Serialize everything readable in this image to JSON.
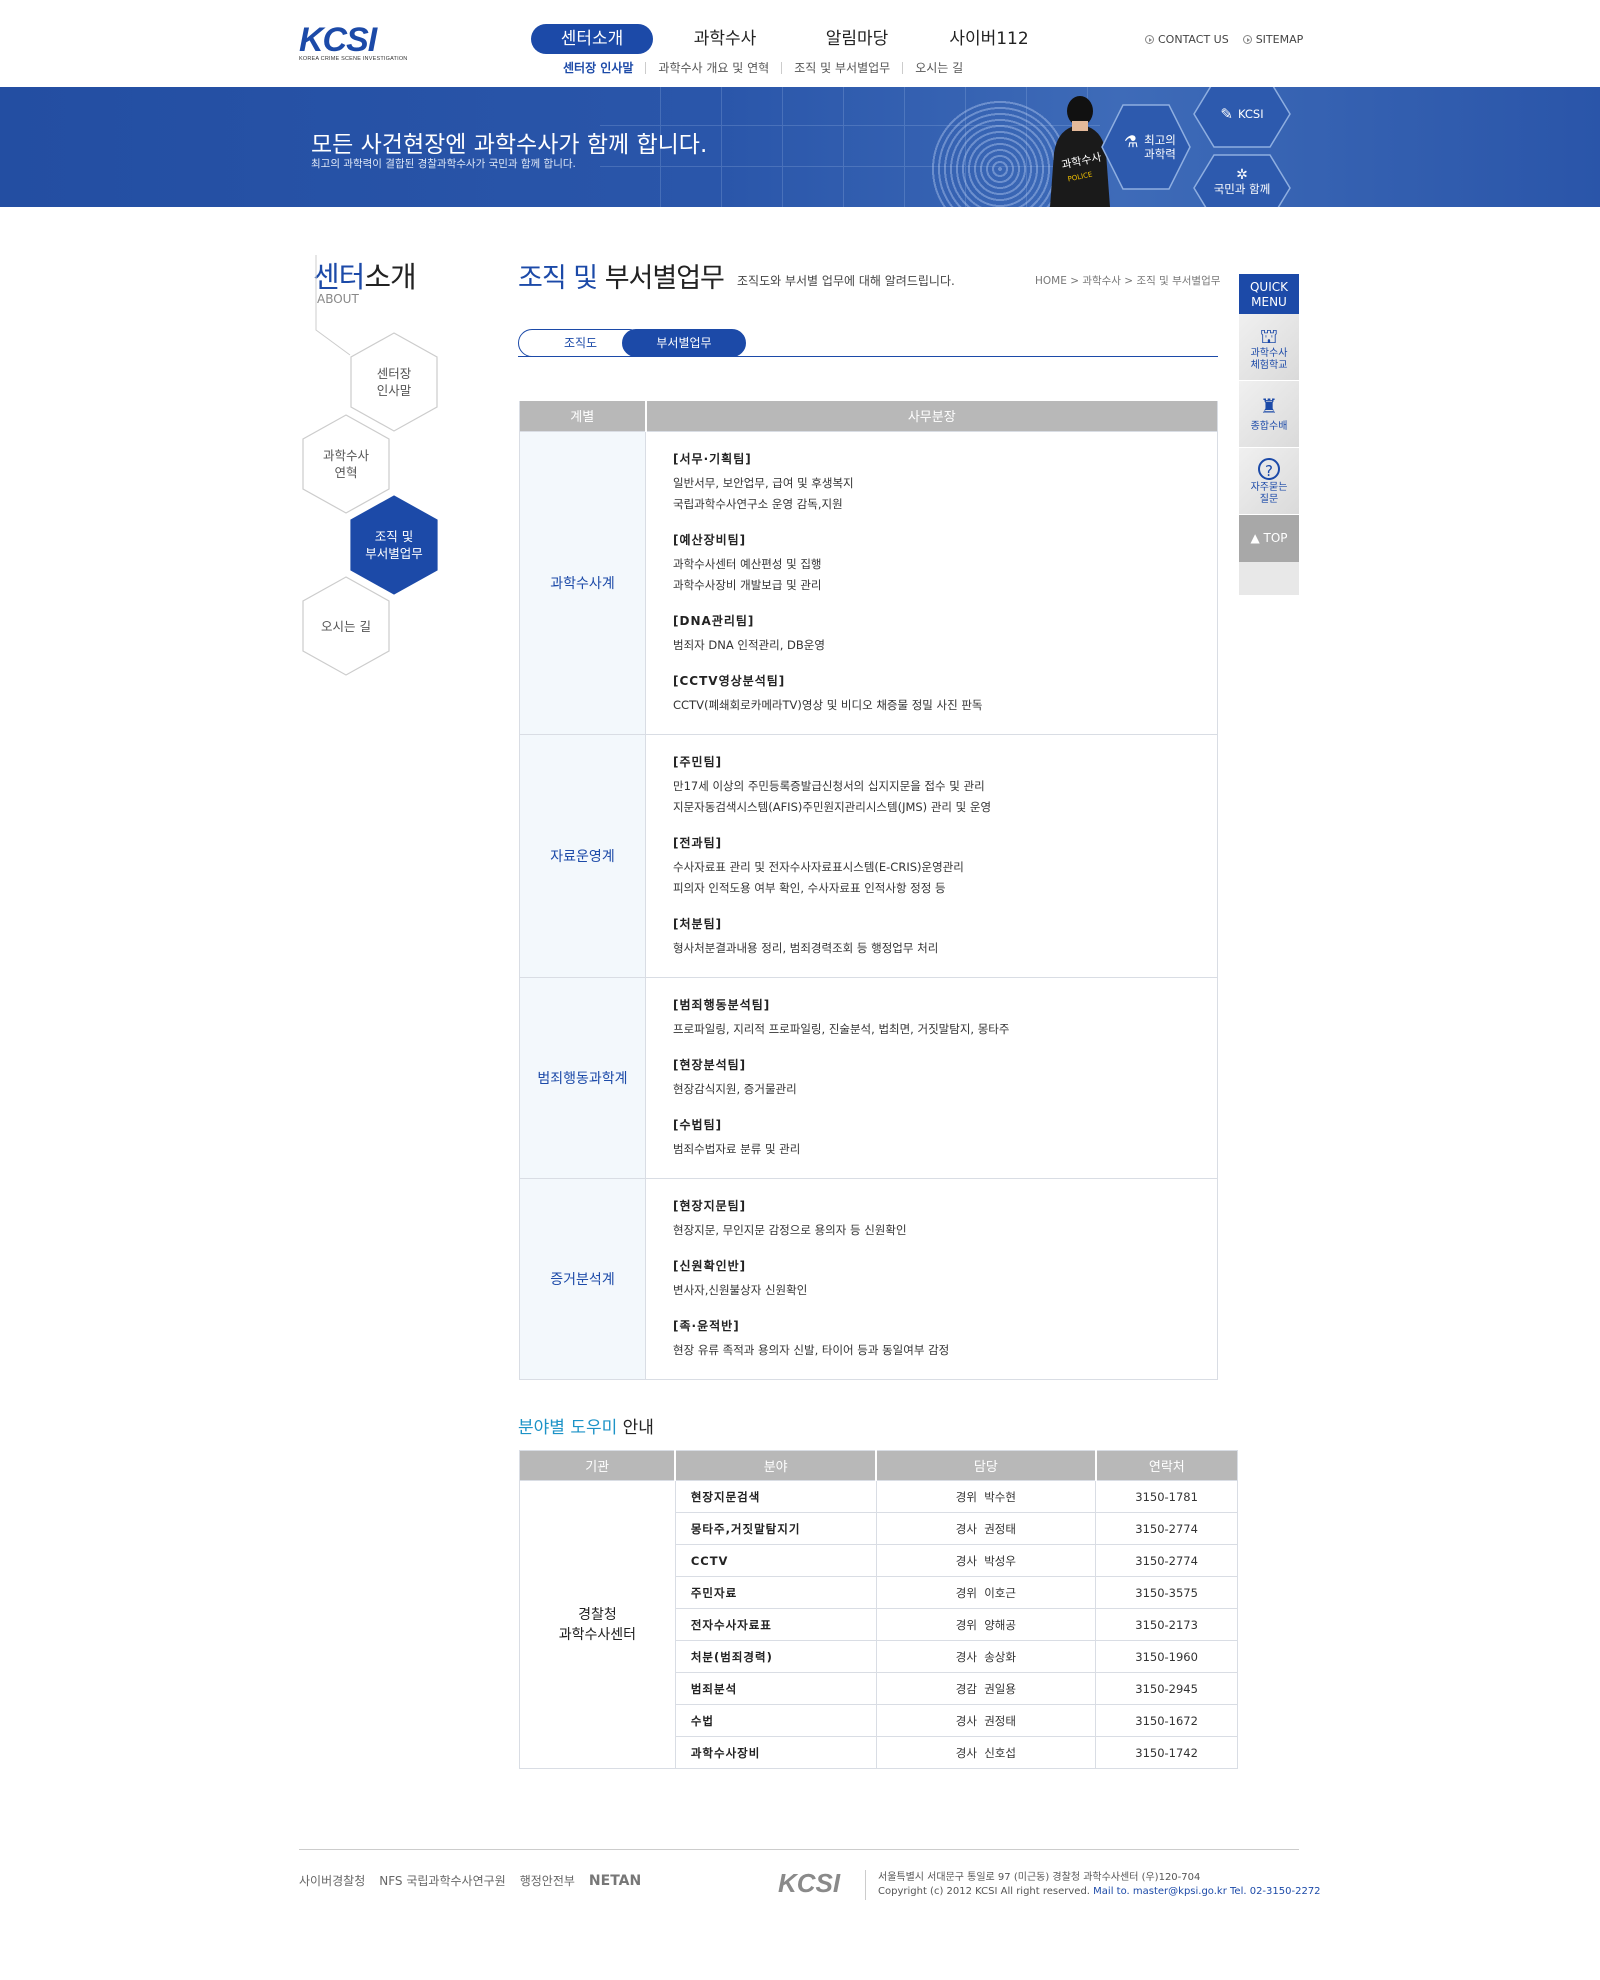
{
  "header": {
    "logo_text": "KCSI",
    "logo_sub": "KOREA CRIME SCENE INVESTIGATION",
    "gnb": [
      "센터소개",
      "과학수사",
      "알림마당",
      "사이버112"
    ],
    "lnb": [
      "센터장 인사말",
      "과학수사 개요 및 연혁",
      "조직 및 부서별업무",
      "오시는 길"
    ],
    "util": [
      "CONTACT US",
      "SITEMAP"
    ]
  },
  "banner": {
    "title": "모든 사건현장엔 과학수사가 함께 합니다.",
    "subtitle": "최고의 과학력이 결합된 경찰과학수사가 국민과 함께 합니다.",
    "person_badge": "과학수사",
    "person_police": "POLICE",
    "hex1": "최고의\n과학력",
    "hex2": "KCSI",
    "hex3": "국민과 함께"
  },
  "side": {
    "title_blue": "센터",
    "title_rest": "소개",
    "about": "ABOUT",
    "items": [
      "센터장\n인사말",
      "과학수사\n연혁",
      "조직 및\n부서별업무",
      "오시는 길"
    ]
  },
  "content": {
    "title_blue": "조직 및",
    "title_rest": " 부서별업무",
    "desc": "조직도와 부서별 업무에 대해 알려드립니다.",
    "breadcrumb": "HOME > 과학수사 > 조직 및 부서별업무",
    "tabs": [
      "조직도",
      "부서별업무"
    ],
    "table_headers": [
      "계별",
      "사무분장"
    ],
    "rows": [
      {
        "dept": "과학수사계",
        "teams": [
          {
            "name": "[서무·기획팀]",
            "lines": [
              "일반서무, 보안업무, 급여 및 후생복지",
              "국립과학수사연구소 운영 감독,지원"
            ]
          },
          {
            "name": "[예산장비팀]",
            "lines": [
              "과학수사센터 예산편성 및 집행",
              "과학수사장비 개발보급 및 관리"
            ]
          },
          {
            "name": "[DNA관리팀]",
            "lines": [
              "범죄자 DNA 인적관리, DB운영"
            ]
          },
          {
            "name": "[CCTV영상분석팀]",
            "lines": [
              "CCTV(폐쇄회로카메라TV)영상 및 비디오 채증물 정밀 사진 판독"
            ]
          }
        ]
      },
      {
        "dept": "자료운영계",
        "teams": [
          {
            "name": "[주민팀]",
            "lines": [
              "만17세 이상의 주민등록증발급신청서의 십지지문을 접수 및 관리",
              "지문자동검색시스템(AFIS)주민원지관리시스템(JMS) 관리 및 운영"
            ]
          },
          {
            "name": "[전과팀]",
            "lines": [
              "수사자료표 관리 및 전자수사자료표시스템(E-CRIS)운영관리",
              "피의자 인적도용 여부 확인, 수사자료표 인적사항 정정 등"
            ]
          },
          {
            "name": "[처분팀]",
            "lines": [
              "형사처분결과내용 정리, 범죄경력조회 등 행정업무 처리"
            ]
          }
        ]
      },
      {
        "dept": "범죄행동과학계",
        "teams": [
          {
            "name": "[범죄행동분석팀]",
            "lines": [
              "프로파일링, 지리적 프로파일링, 진술분석, 법최면, 거짓말탐지, 몽타주"
            ]
          },
          {
            "name": "[현장분석팀]",
            "lines": [
              "현장감식지원, 증거물관리"
            ]
          },
          {
            "name": "[수법팀]",
            "lines": [
              "범죄수법자료 분류 및 관리"
            ]
          }
        ]
      },
      {
        "dept": "증거분석계",
        "teams": [
          {
            "name": "[현장지문팀]",
            "lines": [
              "현장지문, 무인지문 감정으로 용의자 등 신원확인"
            ]
          },
          {
            "name": "[신원확인반]",
            "lines": [
              "변사자,신원불상자 신원확인"
            ]
          },
          {
            "name": "[족·윤적반]",
            "lines": [
              "현장 유류 족적과 용의자 신발, 타이어 등과 동일여부 감정"
            ]
          }
        ]
      }
    ]
  },
  "helper": {
    "title_blue": "분야별 도우미",
    "title_rest": " 안내",
    "headers": [
      "기관",
      "분야",
      "담당",
      "연락처"
    ],
    "org": "경찰청\n과학수사센터",
    "rows": [
      {
        "field": "현장지문검색",
        "person": "경위  박수현",
        "tel": "3150-1781"
      },
      {
        "field": "몽타주,거짓말탐지기",
        "person": "경사  권정태",
        "tel": "3150-2774"
      },
      {
        "field": "CCTV",
        "person": "경사  박성우",
        "tel": "3150-2774"
      },
      {
        "field": "주민자료",
        "person": "경위  이호근",
        "tel": "3150-3575"
      },
      {
        "field": "전자수사자료표",
        "person": "경위  양해공",
        "tel": "3150-2173"
      },
      {
        "field": "처분(범죄경력)",
        "person": "경사  송상화",
        "tel": "3150-1960"
      },
      {
        "field": "범죄분석",
        "person": "경감  권일용",
        "tel": "3150-2945"
      },
      {
        "field": "수법",
        "person": "경사  권정태",
        "tel": "3150-1672"
      },
      {
        "field": "과학수사장비",
        "person": "경사  신호섭",
        "tel": "3150-1742"
      }
    ]
  },
  "quick": {
    "title": "QUICK\nMENU",
    "items": [
      "과학수사\n체험학교",
      "종합수배",
      "자주묻는\n질문"
    ],
    "top": "▲ TOP"
  },
  "footer": {
    "logos": [
      "사이버경찰청",
      "NFS 국립과학수사연구원",
      "행정안전부",
      "NETAN"
    ],
    "kcsi": "KCSI",
    "address": "서울특별시 서대문구 통일로 97 (미근동) 경찰청 과학수사센터 (우)120-704",
    "copyright": "Copyright (c) 2012 KCSI All right reserved.",
    "mail": "Mail to. master@kpsi.go.kr Tel. 02-3150-2272"
  },
  "colors": {
    "brand": "#1c4aa8",
    "header_gray": "#b8b8b8",
    "dept_bg": "#f3f8fc"
  }
}
